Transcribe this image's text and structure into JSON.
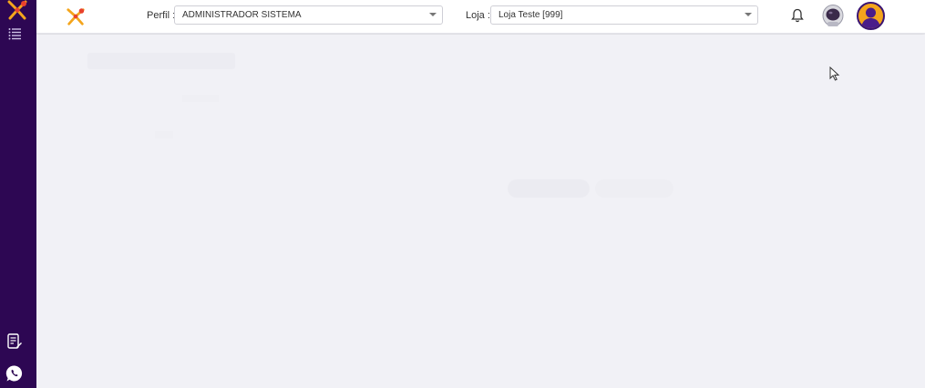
{
  "header": {
    "perfil_label": "Perfil :",
    "perfil_value": "ADMINISTRADOR SISTEMA",
    "loja_label": "Loja :",
    "loja_value": "Loja Teste [999]"
  },
  "icons": {
    "brand": "food-logo-icon",
    "menu": "list-menu-icon",
    "notifications": "bell-icon",
    "report": "document-edit-icon",
    "chat": "whatsapp-icon"
  },
  "colors": {
    "sidebar": "#2d0753",
    "accent": "#f4a51c",
    "logo_red": "#e8412d",
    "whatsapp": "#ffffff"
  }
}
